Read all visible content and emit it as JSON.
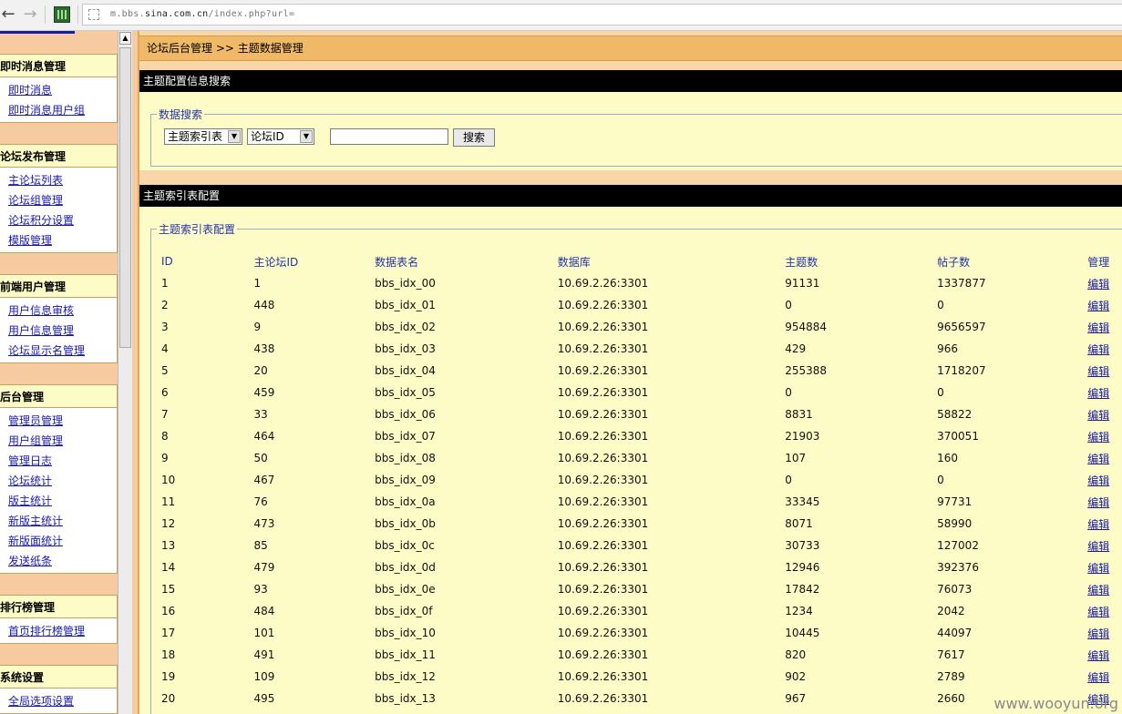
{
  "browser": {
    "url_prefix": "m.bbs.",
    "url_domain": "sina.com.cn",
    "url_path": "/index.php?url="
  },
  "sidebar": {
    "groups": [
      {
        "title": "即时消息管理",
        "items": [
          "即时消息",
          "即时消息用户组"
        ]
      },
      {
        "title": "论坛发布管理",
        "items": [
          "主论坛列表",
          "论坛组管理",
          "论坛积分设置",
          "模版管理"
        ]
      },
      {
        "title": "前端用户管理",
        "items": [
          "用户信息审核",
          "用户信息管理",
          "论坛显示名管理"
        ]
      },
      {
        "title": "后台管理",
        "items": [
          "管理员管理",
          "用户组管理",
          "管理日志",
          "论坛统计",
          "版主统计",
          "新版主统计",
          "新版面统计",
          "发送纸条"
        ]
      },
      {
        "title": "排行榜管理",
        "items": [
          "首页排行榜管理"
        ]
      },
      {
        "title": "系统设置",
        "items": [
          "全局选项设置"
        ]
      }
    ]
  },
  "breadcrumb": "论坛后台管理 >> 主题数据管理",
  "search_section": {
    "title": "主题配置信息搜索",
    "legend": "数据搜索",
    "select1": "主题索引表",
    "select2": "论坛ID",
    "input_value": "",
    "button": "搜索"
  },
  "index_section": {
    "title": "主题索引表配置",
    "legend": "主题索引表配置",
    "columns": [
      "ID",
      "主论坛ID",
      "数据表名",
      "数据库",
      "主题数",
      "帖子数",
      "管理"
    ],
    "edit_label": "编辑",
    "rows": [
      [
        "1",
        "1",
        "bbs_idx_00",
        "10.69.2.26:3301",
        "91131",
        "1337877"
      ],
      [
        "2",
        "448",
        "bbs_idx_01",
        "10.69.2.26:3301",
        "0",
        "0"
      ],
      [
        "3",
        "9",
        "bbs_idx_02",
        "10.69.2.26:3301",
        "954884",
        "9656597"
      ],
      [
        "4",
        "438",
        "bbs_idx_03",
        "10.69.2.26:3301",
        "429",
        "966"
      ],
      [
        "5",
        "20",
        "bbs_idx_04",
        "10.69.2.26:3301",
        "255388",
        "1718207"
      ],
      [
        "6",
        "459",
        "bbs_idx_05",
        "10.69.2.26:3301",
        "0",
        "0"
      ],
      [
        "7",
        "33",
        "bbs_idx_06",
        "10.69.2.26:3301",
        "8831",
        "58822"
      ],
      [
        "8",
        "464",
        "bbs_idx_07",
        "10.69.2.26:3301",
        "21903",
        "370051"
      ],
      [
        "9",
        "50",
        "bbs_idx_08",
        "10.69.2.26:3301",
        "107",
        "160"
      ],
      [
        "10",
        "467",
        "bbs_idx_09",
        "10.69.2.26:3301",
        "0",
        "0"
      ],
      [
        "11",
        "76",
        "bbs_idx_0a",
        "10.69.2.26:3301",
        "33345",
        "97731"
      ],
      [
        "12",
        "473",
        "bbs_idx_0b",
        "10.69.2.26:3301",
        "8071",
        "58990"
      ],
      [
        "13",
        "85",
        "bbs_idx_0c",
        "10.69.2.26:3301",
        "30733",
        "127002"
      ],
      [
        "14",
        "479",
        "bbs_idx_0d",
        "10.69.2.26:3301",
        "12946",
        "392376"
      ],
      [
        "15",
        "93",
        "bbs_idx_0e",
        "10.69.2.26:3301",
        "17842",
        "76073"
      ],
      [
        "16",
        "484",
        "bbs_idx_0f",
        "10.69.2.26:3301",
        "1234",
        "2042"
      ],
      [
        "17",
        "101",
        "bbs_idx_10",
        "10.69.2.26:3301",
        "10445",
        "44097"
      ],
      [
        "18",
        "491",
        "bbs_idx_11",
        "10.69.2.26:3301",
        "820",
        "7617"
      ],
      [
        "19",
        "109",
        "bbs_idx_12",
        "10.69.2.26:3301",
        "902",
        "2789"
      ],
      [
        "20",
        "495",
        "bbs_idx_13",
        "10.69.2.26:3301",
        "967",
        "2660"
      ]
    ]
  },
  "watermark": "www.wooyun.org"
}
